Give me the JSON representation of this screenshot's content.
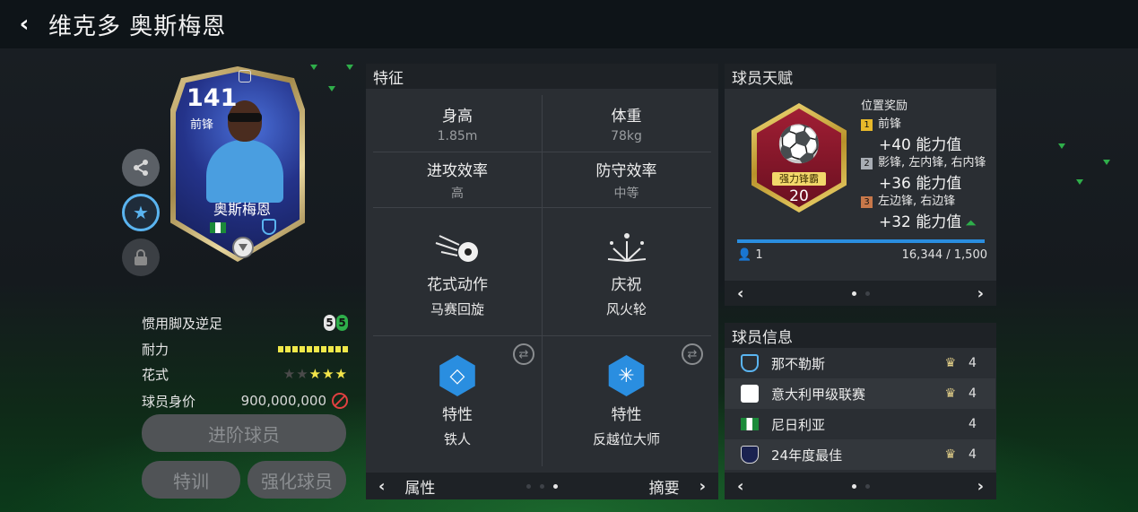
{
  "header": {
    "title": "维克多 奥斯梅恩",
    "back_icon": "‹"
  },
  "card": {
    "rating": "141",
    "position": "前锋",
    "name": "奥斯梅恩"
  },
  "side_buttons": {
    "share": "share",
    "favorite": "★",
    "lock": "lock"
  },
  "stats": {
    "foot_label": "惯用脚及逆足",
    "foot_main": "5",
    "foot_weak": "5",
    "stamina_label": "耐力",
    "stamina_level": 1.0,
    "skill_label": "花式",
    "skill_stars": 3,
    "skill_max": 5,
    "value_label": "球员身价",
    "value": "900,000,000"
  },
  "buttons": {
    "advance": "进阶球员",
    "training": "特训",
    "enhance": "强化球员"
  },
  "traits": {
    "title": "特征",
    "height_label": "身高",
    "height_value": "1.85m",
    "weight_label": "体重",
    "weight_value": "78kg",
    "attack_label": "进攻效率",
    "attack_value": "高",
    "defense_label": "防守效率",
    "defense_value": "中等",
    "skill_move_label": "花式动作",
    "skill_move_value": "马赛回旋",
    "celebration_label": "庆祝",
    "celebration_value": "风火轮",
    "trait1_label": "特性",
    "trait1_value": "铁人",
    "trait2_label": "特性",
    "trait2_value": "反越位大师",
    "nav_left": "属性",
    "nav_right": "摘要"
  },
  "talent": {
    "title": "球员天赋",
    "badge_label": "强力锋霸",
    "badge_level": "20",
    "bonus_title": "位置奖励",
    "bonuses": [
      {
        "rank": "1",
        "positions": "前锋",
        "value": "+40 能力值",
        "color": "#e8b92a"
      },
      {
        "rank": "2",
        "positions": "影锋, 左内锋, 右内锋",
        "value": "+36 能力值",
        "color": "#a8adb4"
      },
      {
        "rank": "3",
        "positions": "左边锋, 右边锋",
        "value": "+32 能力值",
        "color": "#c8784a"
      }
    ],
    "progress": 1.0,
    "count": "1",
    "progress_text": "16,344 / 1,500"
  },
  "info": {
    "title": "球员信息",
    "rows": [
      {
        "name": "那不勒斯",
        "num": "4"
      },
      {
        "name": "意大利甲级联赛",
        "num": "4"
      },
      {
        "name": "尼日利亚",
        "num": "4"
      },
      {
        "name": "24年度最佳",
        "num": "4"
      }
    ]
  },
  "colors": {
    "accent": "#2a8ee0",
    "star": "#f4e64a",
    "green": "#2eae4a"
  }
}
